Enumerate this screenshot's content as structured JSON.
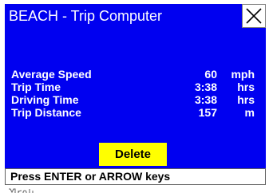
{
  "window": {
    "title": "BEACH - Trip Computer",
    "close_icon": "close-icon"
  },
  "colors": {
    "panel": "#0000f0",
    "text_on_panel": "#ffffff",
    "delete_button": "#ffff00"
  },
  "stats": [
    {
      "label": "Average Speed",
      "value": "60",
      "unit": "mph"
    },
    {
      "label": "Trip Time",
      "value": "3:38",
      "unit": "hrs"
    },
    {
      "label": "Driving Time",
      "value": "3:38",
      "unit": "hrs"
    },
    {
      "label": "Trip Distance",
      "value": "157",
      "unit": "m"
    }
  ],
  "delete_label": "Delete",
  "status_message": "Press ENTER or ARROW keys"
}
